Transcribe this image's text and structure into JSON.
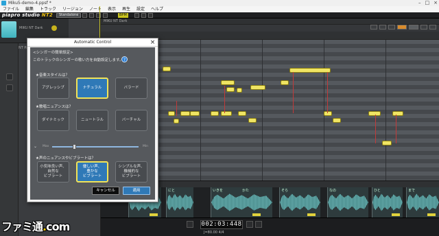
{
  "window": {
    "title": "Miku5-demo-4.ppsf *",
    "controls": [
      "–",
      "□",
      "×"
    ]
  },
  "menu": [
    "ファイル",
    "編集",
    "トラック",
    "リージョン",
    "ノート",
    "表示",
    "再生",
    "設定",
    "ヘルプ"
  ],
  "toolbar": {
    "logo_main": "piapro studio ",
    "logo_nt": "NT",
    "logo_suffix": "2",
    "badge": "Standalone",
    "yellow_btn": "BPM"
  },
  "track": {
    "name": "MIKU NT Dark"
  },
  "editor": {
    "header_track": "MIKU NT Dark",
    "tools": [
      "NOTE",
      "DYN",
      "VEL",
      "PIT"
    ]
  },
  "left_panel": {
    "tab": "NT Parameter"
  },
  "transport": {
    "time": "002:03:448",
    "sub": "J=80.00  4/4"
  },
  "watermark": {
    "text": "ファミ通",
    "dot": ".",
    "com": "com"
  },
  "dialog": {
    "title": "Automatic Control",
    "close": "×",
    "heading": "<シンガーの簡単設定>",
    "subtitle": "このトラックのシンガーの歌い方を自動設定します。",
    "help": "?",
    "section1": "★音楽スタイルは？",
    "style_options": [
      "アグレッシブ",
      "ナチュラル",
      "バラード"
    ],
    "section2": "★歌唱ニュアンスは？",
    "nuance_options": [
      "ダイナミック",
      "ニュートラル",
      "バーチャル"
    ],
    "slider": {
      "max_label": "Max",
      "min_label": "Min",
      "value": 0.25
    },
    "section3": "★声のニュアンスやビブラートは？",
    "vibrato_options": [
      "小気味良い声、\n自然な\nビブラート",
      "優しい声、\n豊かな\nビブラート",
      "シンプルな声、\n機械的な\nビブラート"
    ],
    "cancel": "キャンセル",
    "ok": "適用"
  },
  "wave_lyrics": [
    "ここ",
    "にと",
    "いきを",
    "かた",
    "そら",
    "なの",
    "ひと",
    "まで"
  ]
}
